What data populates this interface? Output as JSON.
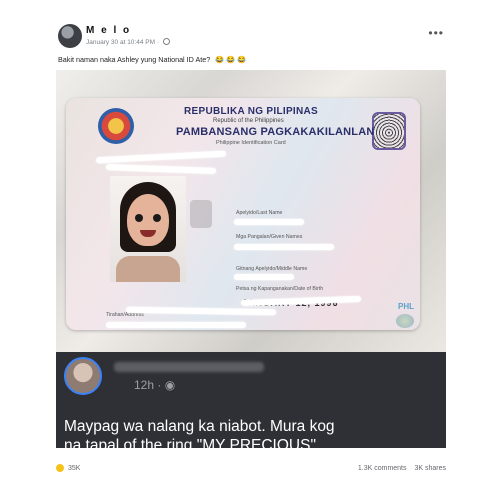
{
  "post": {
    "author": "M e l o",
    "timestamp": "January 30 at 10:44 PM",
    "caption": "Bakit naman naka Ashley yung National ID Ate?",
    "caption_emoji": "😂 😂 😂"
  },
  "id_card": {
    "republika": "REPUBLIKA NG PILIPINAS",
    "republic": "Republic of the Philippines",
    "pambansang": "PAMBANSANG PAGKAKAKILANLAN",
    "identification": "Philippine Identification Card",
    "label_lastname": "Apelyido/Last Name",
    "label_given": "Mga Pangalan/Given Names",
    "label_middle": "Gitnang Apelyido/Middle Name",
    "label_dob": "Petsa ng Kapanganakan/Date of Birth",
    "dob_value": "JANUARY 12, 1996",
    "label_address": "Tirahan/Address",
    "phl": "PHL"
  },
  "overlay": {
    "time": "12h · ",
    "line1": "Maypag wa nalang ka niabot. Mura kog",
    "line2": "na tapal of the ring \"MY PRECIOUS\""
  },
  "footer": {
    "reactions": "35K",
    "comments": "1.3K comments",
    "shares": "3K shares"
  },
  "colors": {
    "accent": "#3b82f6",
    "overlay_bg": "#2e3035"
  }
}
